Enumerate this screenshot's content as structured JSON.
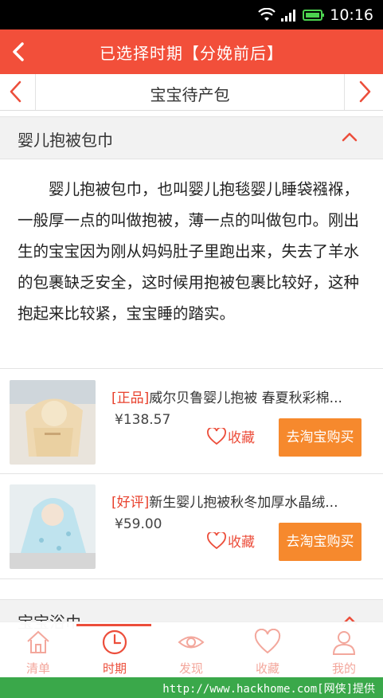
{
  "status_bar": {
    "time": "10:16"
  },
  "header": {
    "title": "已选择时期【分娩前后】"
  },
  "category": {
    "title": "宝宝待产包"
  },
  "sections": [
    {
      "title": "婴儿抱被包巾",
      "description": "婴儿抱被包巾，也叫婴儿抱毯婴儿睡袋襁褓，一般厚一点的叫做抱被，薄一点的叫做包巾。刚出生的宝宝因为刚从妈妈肚子里跑出来，失去了羊水的包裹缺乏安全，这时候用抱被包裹比较好，这种抱起来比较紧，宝宝睡的踏实。",
      "products": [
        {
          "tag": "[正品]",
          "name": "威尔贝鲁婴儿抱被 春夏秋彩棉...",
          "price": "¥138.57",
          "fav_label": "收藏",
          "buy_label": "去淘宝购买"
        },
        {
          "tag": "[好评]",
          "name": "新生婴儿抱被秋冬加厚水晶绒...",
          "price": "¥59.00",
          "fav_label": "收藏",
          "buy_label": "去淘宝购买"
        }
      ]
    },
    {
      "title": "宝宝浴巾"
    }
  ],
  "tabs": [
    {
      "label": "清单",
      "icon": "home-icon"
    },
    {
      "label": "时期",
      "icon": "clock-icon",
      "active": true
    },
    {
      "label": "发现",
      "icon": "eye-icon"
    },
    {
      "label": "收藏",
      "icon": "heart-icon"
    },
    {
      "label": "我的",
      "icon": "user-icon"
    }
  ],
  "footer": {
    "text": "http://www.hackhome.com[网侠]提供"
  },
  "colors": {
    "accent": "#f24f3a",
    "buy": "#f6892d",
    "footer": "#3aa84a"
  }
}
